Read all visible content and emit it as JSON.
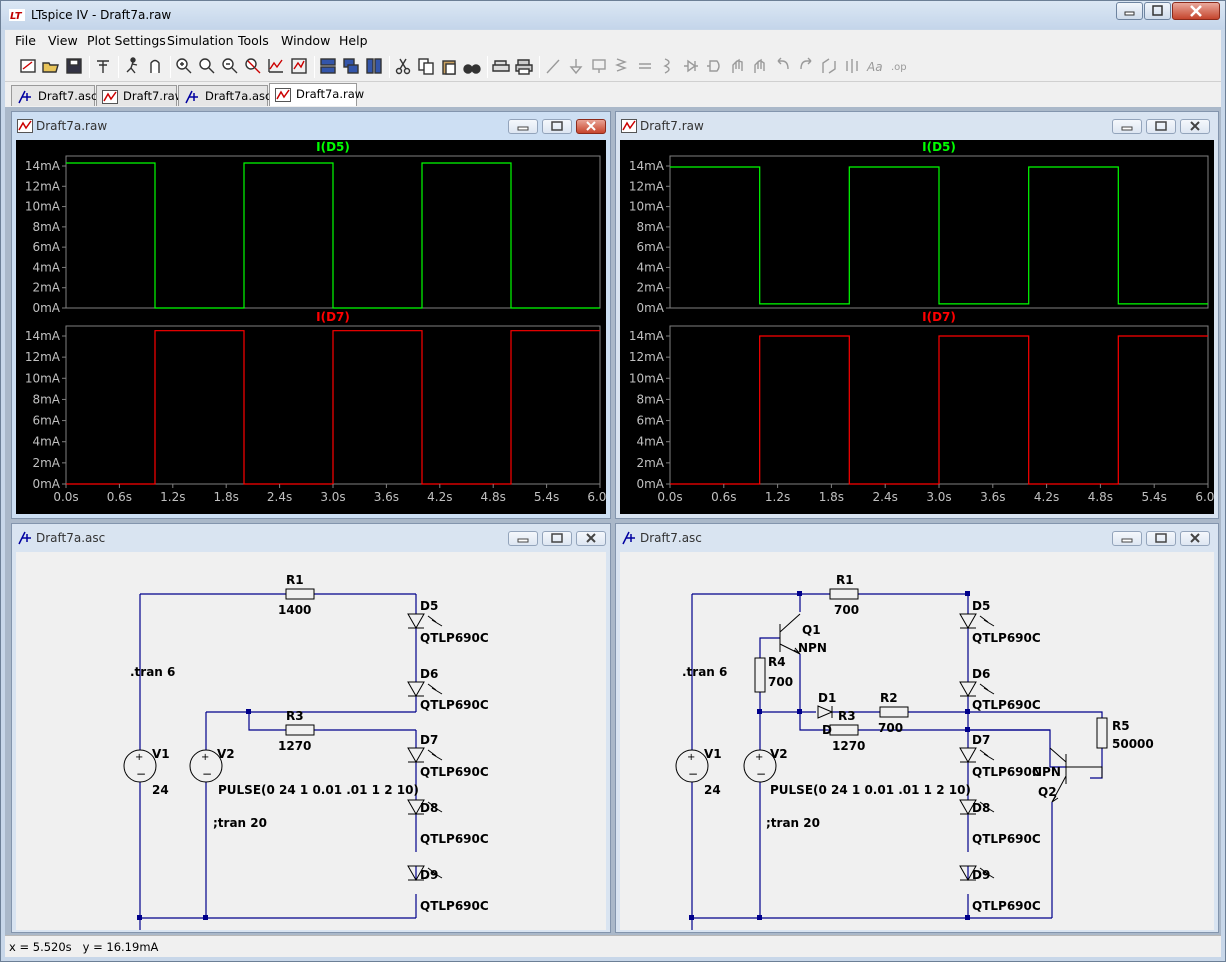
{
  "app": {
    "title": "LTspice IV - Draft7a.raw",
    "logo_text": "LT"
  },
  "menu": [
    "File",
    "View",
    "Plot Settings",
    "Simulation",
    "Tools",
    "Window",
    "Help"
  ],
  "toolbar_icons": [
    "new-schematic-icon",
    "open-icon",
    "save-icon",
    "control-panel-icon",
    "run-icon",
    "halt-icon",
    "zoom-in-icon",
    "zoom-area-icon",
    "zoom-out-icon",
    "zoom-cancel-icon",
    "autorange-icon",
    "pick-visible-traces-icon",
    "tile-horizontal-icon",
    "cascade-icon",
    "tile-vertical-icon",
    "cut-icon",
    "copy-icon",
    "paste-icon",
    "find-icon",
    "print-setup-icon",
    "print-icon",
    "draw-wire-icon",
    "ground-icon",
    "label-net-icon",
    "resistor-icon",
    "capacitor-icon",
    "inductor-icon",
    "diode-icon",
    "component-icon",
    "move-icon",
    "drag-icon",
    "undo-icon",
    "redo-icon",
    "rotate-icon",
    "mirror-icon",
    "text-icon",
    "spice-directive-icon"
  ],
  "tabs": [
    {
      "label": "Draft7.asc",
      "kind": "schematic"
    },
    {
      "label": "Draft7.raw",
      "kind": "waveform"
    },
    {
      "label": "Draft7a.asc",
      "kind": "schematic"
    },
    {
      "label": "Draft7a.raw",
      "kind": "waveform",
      "active": true
    }
  ],
  "windows": {
    "wave_left": {
      "title": "Draft7a.raw"
    },
    "wave_right": {
      "title": "Draft7.raw"
    },
    "schem_left": {
      "title": "Draft7a.asc"
    },
    "schem_right": {
      "title": "Draft7.asc"
    }
  },
  "plot_colors": {
    "d5": "#00ff00",
    "d7": "#ff0000",
    "axis": "#808080",
    "background": "#000000"
  },
  "y_ticks": [
    "14mA",
    "12mA",
    "10mA",
    "8mA",
    "6mA",
    "4mA",
    "2mA",
    "0mA"
  ],
  "x_ticks": [
    "0.0s",
    "0.6s",
    "1.2s",
    "1.8s",
    "2.4s",
    "3.0s",
    "3.6s",
    "4.2s",
    "4.8s",
    "5.4s",
    "6.0s"
  ],
  "chart_data": [
    {
      "type": "line",
      "window": "Draft7a.raw",
      "title": "I(D5)",
      "x_unit": "s",
      "ylim": [
        0,
        15
      ],
      "xlim": [
        0,
        6
      ],
      "series": [
        {
          "name": "I(D5)",
          "x": [
            0,
            1,
            1,
            2,
            2,
            3,
            3,
            4,
            4,
            5,
            5,
            6
          ],
          "y": [
            14.3,
            14.3,
            0,
            0,
            14.3,
            14.3,
            0,
            0,
            14.3,
            14.3,
            0,
            0
          ]
        }
      ]
    },
    {
      "type": "line",
      "window": "Draft7a.raw",
      "title": "I(D7)",
      "x_unit": "s",
      "ylim": [
        0,
        15
      ],
      "xlim": [
        0,
        6
      ],
      "series": [
        {
          "name": "I(D7)",
          "x": [
            0,
            1,
            1,
            2,
            2,
            3,
            3,
            4,
            4,
            5,
            5,
            6
          ],
          "y": [
            0,
            0,
            14.5,
            14.5,
            0,
            0,
            14.5,
            14.5,
            0,
            0,
            14.5,
            14.5
          ]
        }
      ]
    },
    {
      "type": "line",
      "window": "Draft7.raw",
      "title": "I(D5)",
      "x_unit": "s",
      "ylim": [
        0,
        15
      ],
      "xlim": [
        0,
        6
      ],
      "series": [
        {
          "name": "I(D5)",
          "x": [
            0,
            1,
            1,
            2,
            2,
            3,
            3,
            4,
            4,
            5,
            5,
            6
          ],
          "y": [
            13.9,
            13.9,
            0.4,
            0.4,
            13.9,
            13.9,
            0.4,
            0.4,
            13.9,
            13.9,
            0.4,
            0.4
          ]
        }
      ]
    },
    {
      "type": "line",
      "window": "Draft7.raw",
      "title": "I(D7)",
      "x_unit": "s",
      "ylim": [
        0,
        15
      ],
      "xlim": [
        0,
        6
      ],
      "series": [
        {
          "name": "I(D7)",
          "x": [
            0,
            1,
            1,
            2,
            2,
            3,
            3,
            4,
            4,
            5,
            5,
            6
          ],
          "y": [
            0,
            0,
            14,
            14,
            0,
            0,
            14,
            14,
            0,
            0,
            14,
            14
          ]
        }
      ]
    }
  ],
  "schematic_left": {
    "r1": {
      "name": "R1",
      "value": "1400"
    },
    "r3": {
      "name": "R3",
      "value": "1270"
    },
    "v1": {
      "name": "V1",
      "value": "24"
    },
    "v2": {
      "name": "V2",
      "value": "PULSE(0 24 1 0.01 .01 1 2 10)"
    },
    "tran": ".tran 6",
    "tran_comment": ";tran 20",
    "diodes": [
      {
        "name": "D5",
        "model": "QTLP690C"
      },
      {
        "name": "D6",
        "model": "QTLP690C"
      },
      {
        "name": "D7",
        "model": "QTLP690C"
      },
      {
        "name": "D8",
        "model": "QTLP690C"
      },
      {
        "name": "D9",
        "model": "QTLP690C"
      }
    ]
  },
  "schematic_right": {
    "r1": {
      "name": "R1",
      "value": "700"
    },
    "r2": {
      "name": "R2",
      "value": "700"
    },
    "r3": {
      "name": "R3",
      "value": "1270"
    },
    "r4": {
      "name": "R4",
      "value": "700"
    },
    "r5": {
      "name": "R5",
      "value": "50000"
    },
    "q1": {
      "name": "Q1",
      "type": "NPN"
    },
    "q2": {
      "name": "Q2",
      "type": "NPN"
    },
    "d1": {
      "name": "D1",
      "model": "D"
    },
    "v1": {
      "name": "V1",
      "value": "24"
    },
    "v2": {
      "name": "V2",
      "value": "PULSE(0 24 1 0.01 .01 1 2 10)"
    },
    "tran": ".tran 6",
    "tran_comment": ";tran 20",
    "diodes": [
      {
        "name": "D5",
        "model": "QTLP690C"
      },
      {
        "name": "D6",
        "model": "QTLP690C"
      },
      {
        "name": "D7",
        "model": "QTLP690C"
      },
      {
        "name": "D8",
        "model": "QTLP690C"
      },
      {
        "name": "D9",
        "model": "QTLP690C"
      }
    ]
  },
  "status": {
    "x": "x = 5.520s",
    "y": "y = 16.19mA"
  }
}
